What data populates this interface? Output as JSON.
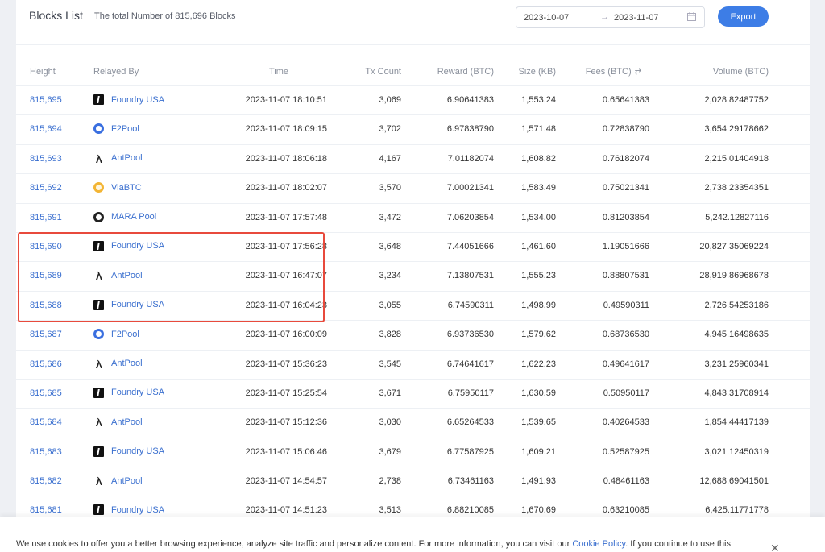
{
  "header": {
    "title": "Blocks List",
    "subtitle": "The total Number of 815,696 Blocks",
    "date_from": "2023-10-07",
    "date_sep": "→",
    "date_to": "2023-11-07",
    "export_label": "Export"
  },
  "columns": {
    "height": "Height",
    "relayed_by": "Relayed By",
    "time": "Time",
    "tx_count": "Tx Count",
    "reward": "Reward (BTC)",
    "size": "Size (KB)",
    "fees": "Fees (BTC)",
    "fees_sort_icon": "⇄",
    "volume": "Volume (BTC)"
  },
  "rows": [
    {
      "height": "815,695",
      "pool": "Foundry USA",
      "icon": "foundry",
      "time": "2023-11-07 18:10:51",
      "tx": "3,069",
      "reward": "6.90641383",
      "size": "1,553.24",
      "fees": "0.65641383",
      "volume": "2,028.82487752"
    },
    {
      "height": "815,694",
      "pool": "F2Pool",
      "icon": "f2pool",
      "time": "2023-11-07 18:09:15",
      "tx": "3,702",
      "reward": "6.97838790",
      "size": "1,571.48",
      "fees": "0.72838790",
      "volume": "3,654.29178662"
    },
    {
      "height": "815,693",
      "pool": "AntPool",
      "icon": "antpool",
      "time": "2023-11-07 18:06:18",
      "tx": "4,167",
      "reward": "7.01182074",
      "size": "1,608.82",
      "fees": "0.76182074",
      "volume": "2,215.01404918"
    },
    {
      "height": "815,692",
      "pool": "ViaBTC",
      "icon": "viabtc",
      "time": "2023-11-07 18:02:07",
      "tx": "3,570",
      "reward": "7.00021341",
      "size": "1,583.49",
      "fees": "0.75021341",
      "volume": "2,738.23354351"
    },
    {
      "height": "815,691",
      "pool": "MARA Pool",
      "icon": "mara",
      "time": "2023-11-07 17:57:48",
      "tx": "3,472",
      "reward": "7.06203854",
      "size": "1,534.00",
      "fees": "0.81203854",
      "volume": "5,242.12827116"
    },
    {
      "height": "815,690",
      "pool": "Foundry USA",
      "icon": "foundry",
      "time": "2023-11-07 17:56:28",
      "tx": "3,648",
      "reward": "7.44051666",
      "size": "1,461.60",
      "fees": "1.19051666",
      "volume": "20,827.35069224"
    },
    {
      "height": "815,689",
      "pool": "AntPool",
      "icon": "antpool",
      "time": "2023-11-07 16:47:07",
      "tx": "3,234",
      "reward": "7.13807531",
      "size": "1,555.23",
      "fees": "0.88807531",
      "volume": "28,919.86968678"
    },
    {
      "height": "815,688",
      "pool": "Foundry USA",
      "icon": "foundry",
      "time": "2023-11-07 16:04:23",
      "tx": "3,055",
      "reward": "6.74590311",
      "size": "1,498.99",
      "fees": "0.49590311",
      "volume": "2,726.54253186"
    },
    {
      "height": "815,687",
      "pool": "F2Pool",
      "icon": "f2pool",
      "time": "2023-11-07 16:00:09",
      "tx": "3,828",
      "reward": "6.93736530",
      "size": "1,579.62",
      "fees": "0.68736530",
      "volume": "4,945.16498635"
    },
    {
      "height": "815,686",
      "pool": "AntPool",
      "icon": "antpool",
      "time": "2023-11-07 15:36:23",
      "tx": "3,545",
      "reward": "6.74641617",
      "size": "1,622.23",
      "fees": "0.49641617",
      "volume": "3,231.25960341"
    },
    {
      "height": "815,685",
      "pool": "Foundry USA",
      "icon": "foundry",
      "time": "2023-11-07 15:25:54",
      "tx": "3,671",
      "reward": "6.75950117",
      "size": "1,630.59",
      "fees": "0.50950117",
      "volume": "4,843.31708914"
    },
    {
      "height": "815,684",
      "pool": "AntPool",
      "icon": "antpool",
      "time": "2023-11-07 15:12:36",
      "tx": "3,030",
      "reward": "6.65264533",
      "size": "1,539.65",
      "fees": "0.40264533",
      "volume": "1,854.44417139"
    },
    {
      "height": "815,683",
      "pool": "Foundry USA",
      "icon": "foundry",
      "time": "2023-11-07 15:06:46",
      "tx": "3,679",
      "reward": "6.77587925",
      "size": "1,609.21",
      "fees": "0.52587925",
      "volume": "3,021.12450319"
    },
    {
      "height": "815,682",
      "pool": "AntPool",
      "icon": "antpool",
      "time": "2023-11-07 14:54:57",
      "tx": "2,738",
      "reward": "6.73461163",
      "size": "1,491.93",
      "fees": "0.48461163",
      "volume": "12,688.69041501"
    },
    {
      "height": "815,681",
      "pool": "Foundry USA",
      "icon": "foundry",
      "time": "2023-11-07 14:51:23",
      "tx": "3,513",
      "reward": "6.88210085",
      "size": "1,670.69",
      "fees": "0.63210085",
      "volume": "6,425.11771778"
    }
  ],
  "cookie": {
    "text_before": "We use cookies to offer you a better browsing experience, analyze site traffic and personalize content. For more information, you can visit our ",
    "link": "Cookie Policy",
    "text_after": ". If you continue to use this",
    "close": "✕"
  },
  "colors": {
    "accent": "#3d7de6",
    "link": "#3a6fcf",
    "highlight": "#e84a3c"
  }
}
